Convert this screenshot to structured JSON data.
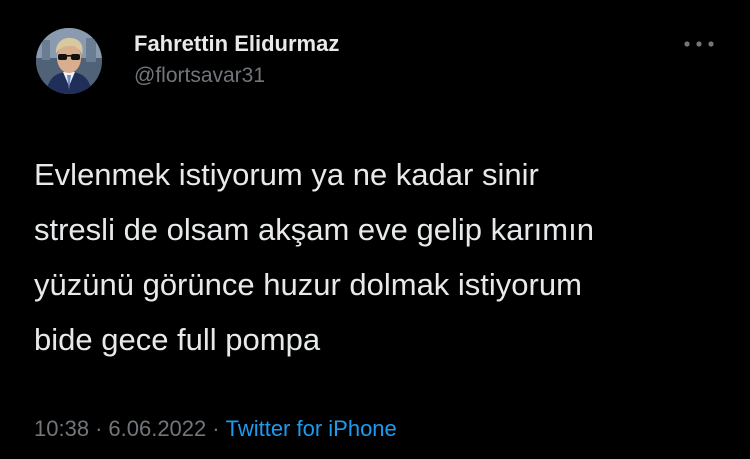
{
  "tweet": {
    "author": {
      "display_name": "Fahrettin Elidurmaz",
      "handle": "@flortsavar31",
      "avatar_icon": "profile-photo"
    },
    "more_icon": "more-horizontal-icon",
    "text": "Evlenmek istiyorum ya ne kadar sinir\nstresli de olsam akşam eve gelip karımın\nyüzünü görünce huzur dolmak istiyorum\nbide gece full pompa",
    "time": "10:38",
    "separator": "·",
    "date": "6.06.2022",
    "source": "Twitter for iPhone"
  },
  "colors": {
    "background": "#000000",
    "primary_text": "#e7e9ea",
    "secondary_text": "#71767b",
    "link": "#1d9bf0"
  }
}
